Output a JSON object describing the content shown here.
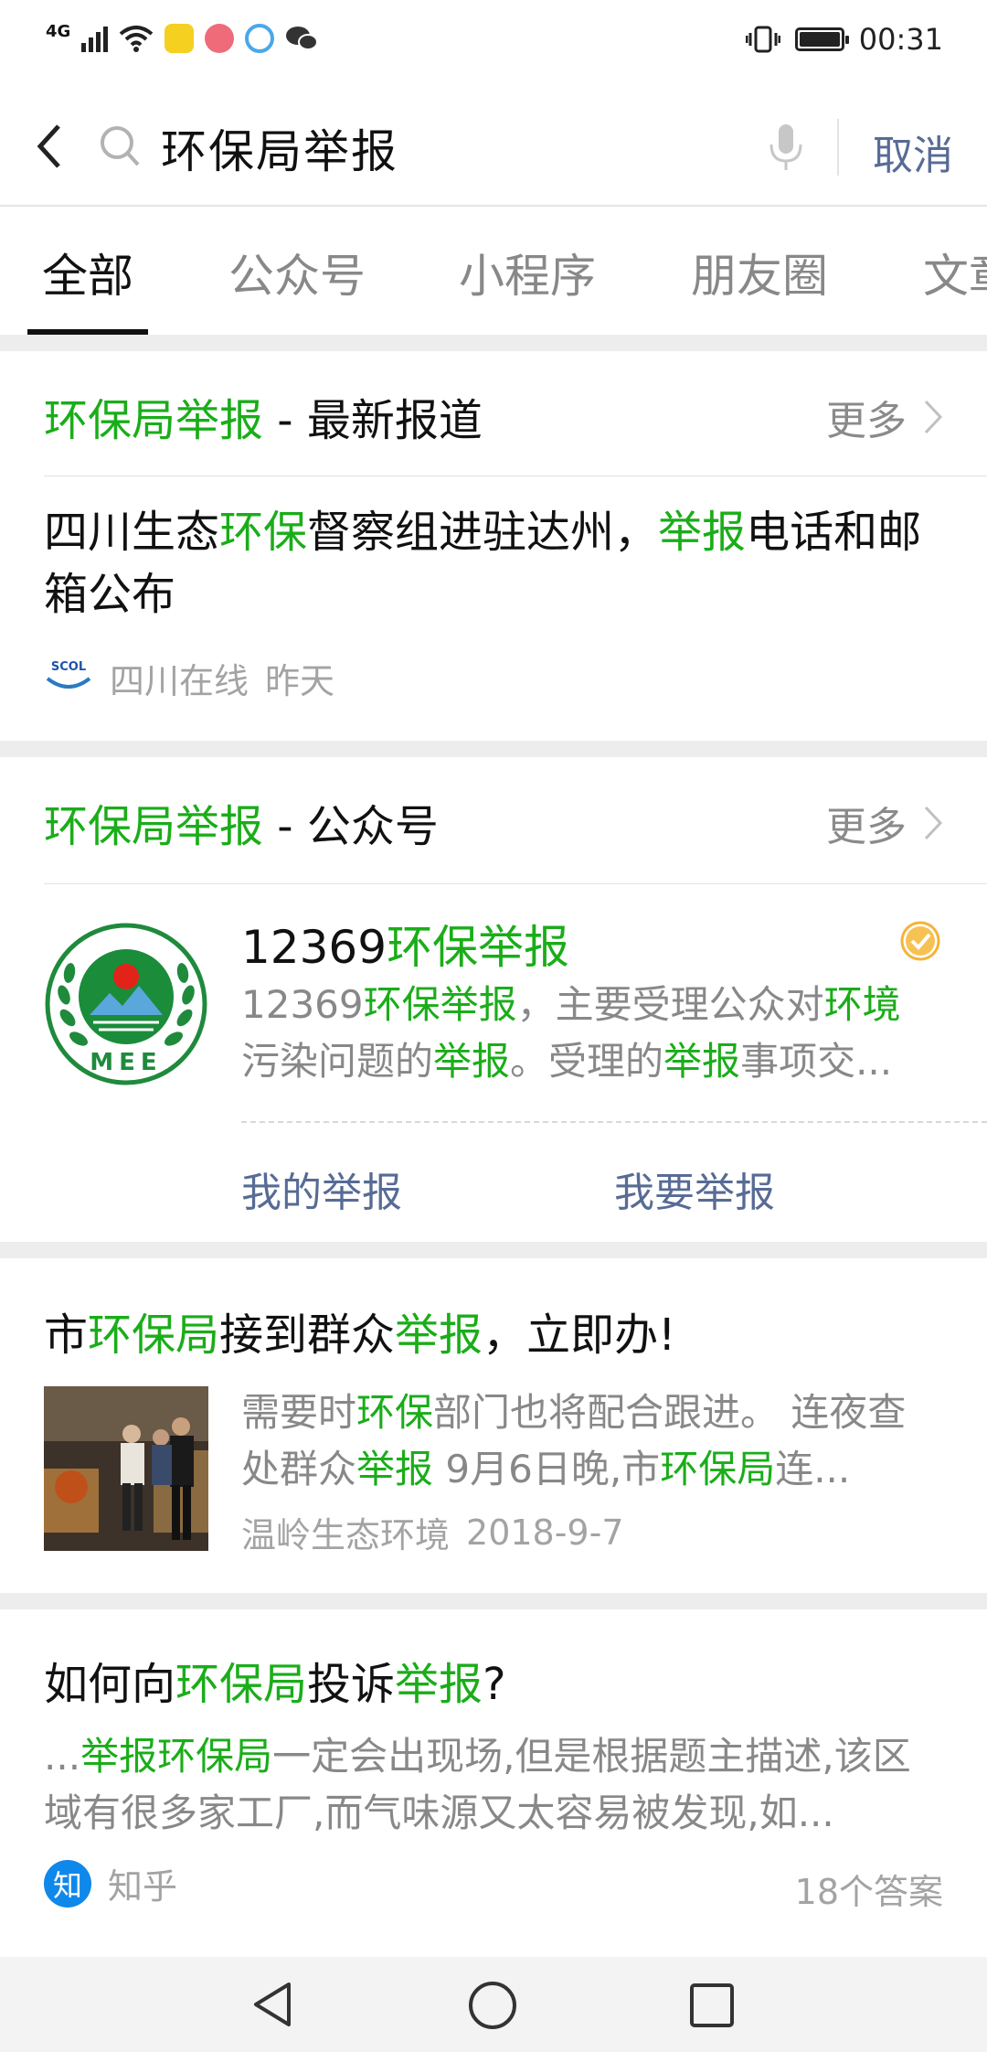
{
  "status_bar": {
    "network": "4G",
    "time": "00:31"
  },
  "search": {
    "query": "环保局举报",
    "cancel_label": "取消"
  },
  "tabs": [
    {
      "label": "全部",
      "active": true
    },
    {
      "label": "公众号",
      "active": false
    },
    {
      "label": "小程序",
      "active": false
    },
    {
      "label": "朋友圈",
      "active": false
    },
    {
      "label": "文章",
      "active": false
    }
  ],
  "news_section": {
    "title_highlight": "环保局举报",
    "title_rest": " - 最新报道",
    "more_label": "更多",
    "item": {
      "title_parts": [
        "四川生态",
        "环保",
        "督察组进驻达州，",
        "举报",
        "电话和邮箱公布"
      ],
      "source": "四川在线",
      "time": "昨天",
      "source_logo_text": "SCOL"
    }
  },
  "account_section": {
    "title_highlight": "环保局举报",
    "title_rest": " - 公众号",
    "more_label": "更多",
    "account": {
      "name_prefix": "12369",
      "name_highlight": "环保举报",
      "desc_parts": [
        "12369",
        "环保举报",
        "，主要受理公众对",
        "环境",
        "污染问题的",
        "举报",
        "。受理的",
        "举报",
        "事项交..."
      ],
      "logo_text": "MEE",
      "menu": [
        "我的举报",
        "我要举报"
      ]
    }
  },
  "article_1": {
    "title_parts": [
      "市",
      "环保局",
      "接到群众",
      "举报",
      "，立即办!"
    ],
    "desc_parts": [
      "需要时",
      "环保",
      "部门也将配合跟进。 连夜查处群众",
      "举报",
      " 9月6日晚,市",
      "环保局",
      "连..."
    ],
    "source": "温岭生态环境",
    "date": "2018-9-7"
  },
  "article_2": {
    "title_parts": [
      "如何向",
      "环保局",
      "投诉",
      "举报",
      "?"
    ],
    "desc_parts": [
      "...",
      "举报环保局",
      "一定会出现场,但是根据题主描述,该区域有很多家工厂,而气味源又太容易被发现,如..."
    ],
    "source": "知乎",
    "source_icon_text": "知",
    "answers": "18个答案"
  },
  "colors": {
    "highlight": "#1aad19",
    "link": "#576b95",
    "background": "#ededed"
  }
}
